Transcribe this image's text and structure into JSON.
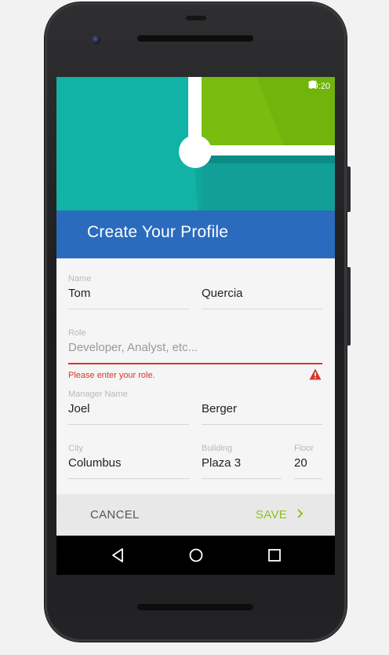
{
  "status_bar": {
    "time": "09:20",
    "icons": [
      "wifi-icon",
      "signal-icon",
      "battery-icon"
    ]
  },
  "header": {
    "title": "Create Your Profile"
  },
  "form": {
    "name": {
      "label": "Name",
      "first": "Tom",
      "last": "Quercia"
    },
    "role": {
      "label": "Role",
      "placeholder": "Developer, Analyst, etc...",
      "value": "",
      "error": "Please enter your role."
    },
    "manager": {
      "label": "Manager Name",
      "first": "Joel",
      "last": "Berger"
    },
    "city": {
      "label": "City",
      "value": "Columbus"
    },
    "building": {
      "label": "Building",
      "value": "Plaza 3"
    },
    "floor": {
      "label": "Floor",
      "value": "20"
    }
  },
  "actions": {
    "cancel_label": "CANCEL",
    "save_label": "SAVE",
    "save_icon": "chevron-right-icon"
  },
  "nav": {
    "icons": [
      "back-icon",
      "home-icon",
      "recents-icon"
    ]
  },
  "colors": {
    "hero_teal": "#12b3a6",
    "hero_green": "#7bbf12",
    "title_blue": "#2a6bbd",
    "error_red": "#d9352b",
    "save_green": "#8bc21f"
  }
}
